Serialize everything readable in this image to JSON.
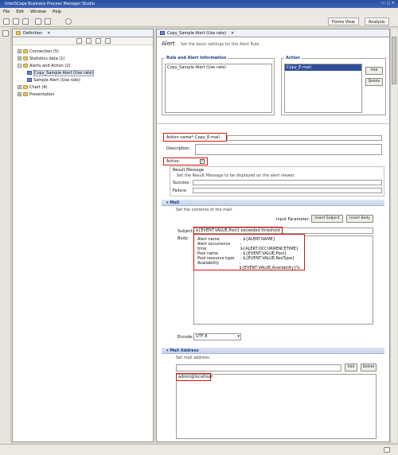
{
  "window": {
    "title": "InterSCape Business Process Manager Studio"
  },
  "menu": [
    "File",
    "Edit",
    "Window",
    "Help"
  ],
  "perspectives": {
    "forms": "Forms View",
    "analysis": "Analysis"
  },
  "left_pane": {
    "tab_label": "Definition",
    "tree": [
      {
        "label": "Connection (5)",
        "level": 1,
        "expanded": false
      },
      {
        "label": "Statistics data (1)",
        "level": 1,
        "expanded": false
      },
      {
        "label": "Alerts and Action (2)",
        "level": 1,
        "expanded": true
      },
      {
        "label": "Copy_Sample Alert (Use rate)",
        "level": 2,
        "selected": true
      },
      {
        "label": "Sample Alert (Use rate)",
        "level": 2
      },
      {
        "label": "Chart (4)",
        "level": 1,
        "expanded": false
      },
      {
        "label": "Presentation",
        "level": 1,
        "expanded": false
      }
    ]
  },
  "editor": {
    "tab_label": "Copy_Sample Alert (Use rate)",
    "heading": "Alert",
    "heading_sub": "Set the basic settings for the Alert Rule.",
    "rule_group": {
      "title": "Rule and Alert Information",
      "item": "Copy_Sample Alert (Use rate)"
    },
    "action_group": {
      "title": "Action",
      "item": "Copy_E-mail",
      "add_label": "Add",
      "delete_label": "Delete"
    },
    "action_name_label": "Action name*:",
    "action_name_value": "Copy_E-mail",
    "description_label": "Description:",
    "active_label": "Active:",
    "result_message": {
      "title": "Result Message",
      "hint": "Set the Result Message to be displayed on the alert viewer.",
      "success_label": "Success:",
      "failure_label": "Failure:"
    },
    "mail": {
      "title": "Mail",
      "hint": "Set the contents of the mail.",
      "input_param_label": "Input Parameter:",
      "insert_subject_label": "Insert Subject",
      "insert_body_label": "Insert Body",
      "subject_label": "Subject:",
      "subject_value": "${EVENT.VALUE,Pool} exceeded threshold",
      "body_label": "Body:",
      "body_lines": [
        [
          "Alert name",
          ": ${ALERT.NAME}"
        ],
        [
          "Alert occurrence time",
          ": ${ALERT.OCCURRENCETIME}"
        ],
        [
          "Pool name",
          ": ${EVENT.VALUE,Pool}"
        ],
        [
          "Pool resource type",
          ": ${EVENT.VALUE,ResType}"
        ],
        [
          "Availability",
          ": ${EVENT.VALUE,Availability}%"
        ]
      ],
      "encode_label": "Encode:",
      "encode_value": "UTF-8"
    },
    "mail_address": {
      "title": "Mail Address",
      "hint": "Set mail address.",
      "add_label": "Add",
      "delete_label": "Delete",
      "entries": [
        "admin@localhost"
      ]
    }
  }
}
